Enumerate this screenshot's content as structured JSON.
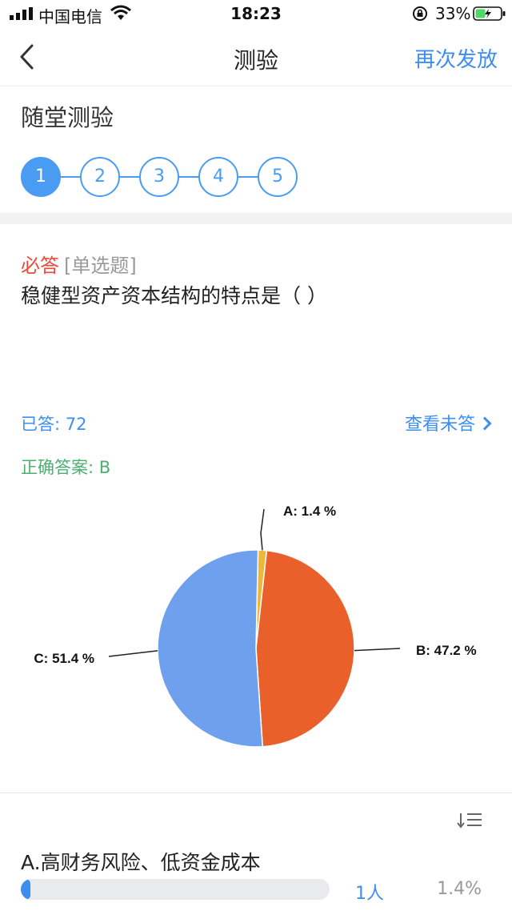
{
  "status_bar": {
    "carrier": "中国电信",
    "time": "18:23",
    "battery": "33%"
  },
  "nav": {
    "title": "测验",
    "resend": "再次发放"
  },
  "section_title": "随堂测验",
  "steps": [
    {
      "label": "1",
      "active": true
    },
    {
      "label": "2",
      "active": false
    },
    {
      "label": "3",
      "active": false
    },
    {
      "label": "4",
      "active": false
    },
    {
      "label": "5",
      "active": false
    }
  ],
  "question": {
    "required": "必答",
    "type": "[单选题]",
    "text": "稳健型资产资本结构的特点是（ ）"
  },
  "stats": {
    "answered": "已答: 72",
    "view_unanswered": "查看未答",
    "correct_answer": "正确答案: B"
  },
  "chart_data": {
    "type": "pie",
    "slices": [
      {
        "label": "A: 1.4 %",
        "category": "A",
        "value": 1.4,
        "color": "#f0b63a"
      },
      {
        "label": "B: 47.2 %",
        "category": "B",
        "value": 47.2,
        "color": "#ea602b"
      },
      {
        "label": "C: 51.4 %",
        "category": "C",
        "value": 51.4,
        "color": "#6ea0ee"
      }
    ]
  },
  "options": [
    {
      "label": "A.高财务风险、低资金成本",
      "count": "1人",
      "percent": "1.4%",
      "fraction": 0.014
    }
  ],
  "colors": {
    "accent": "#3d8ef0",
    "required": "#e84b3c",
    "correct": "#4caf72"
  }
}
